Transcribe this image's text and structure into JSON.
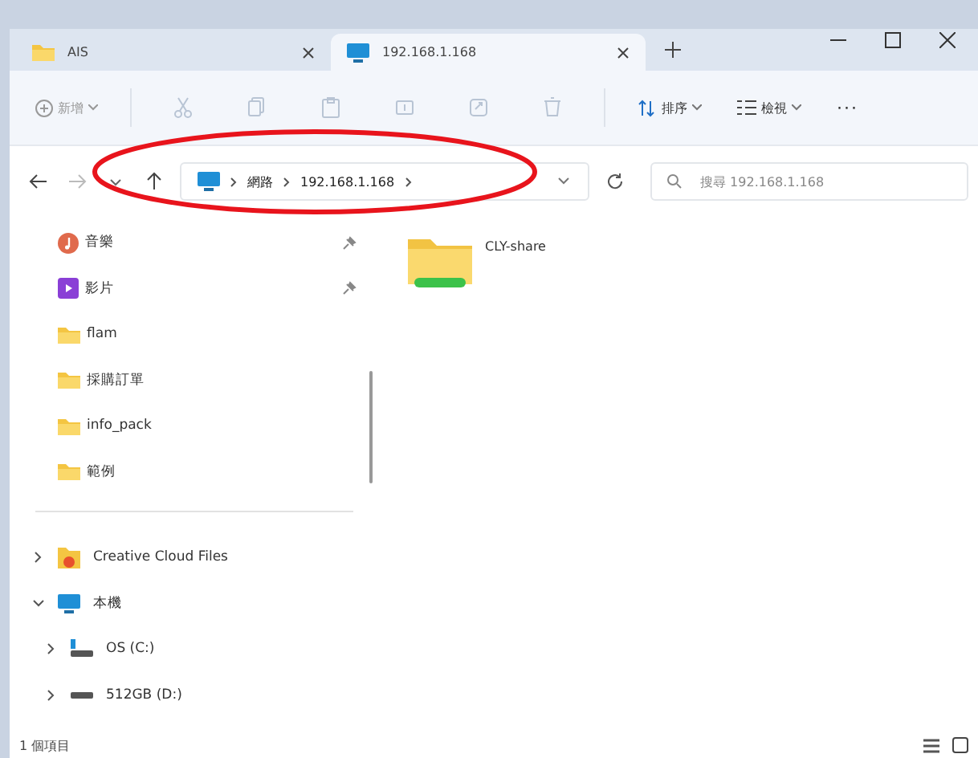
{
  "tabs": [
    {
      "label": "AIS",
      "kind": "folder",
      "selected": false
    },
    {
      "label": "192.168.1.168",
      "kind": "monitor",
      "selected": true
    }
  ],
  "toolbar": {
    "new": "新增",
    "sort": "排序",
    "view": "檢視",
    "more": "···"
  },
  "address": {
    "crumbs": [
      "網路",
      "192.168.1.168"
    ]
  },
  "search": {
    "placeholder": "搜尋 192.168.1.168"
  },
  "quick_access": [
    {
      "label": "音樂",
      "kind": "music",
      "pinned": true
    },
    {
      "label": "影片",
      "kind": "video",
      "pinned": true
    },
    {
      "label": "flam",
      "kind": "folder",
      "pinned": false
    },
    {
      "label": "採購訂單",
      "kind": "folder",
      "pinned": false
    },
    {
      "label": "info_pack",
      "kind": "folder",
      "pinned": false
    },
    {
      "label": "範例",
      "kind": "folder",
      "pinned": false
    }
  ],
  "tree": [
    {
      "label": "Creative Cloud Files",
      "kind": "cloud",
      "expanded": false
    },
    {
      "label": "本機",
      "kind": "pc",
      "expanded": true,
      "children": [
        {
          "label": "OS (C:)",
          "kind": "osdrive",
          "expanded": false
        },
        {
          "label": "512GB (D:)",
          "kind": "drive",
          "expanded": false
        }
      ]
    }
  ],
  "files": [
    {
      "name": "CLY-share",
      "kind": "share"
    }
  ],
  "status_bar": {
    "count": "1 個項目"
  },
  "annotations": [
    {
      "kind": "ellipse",
      "color": "#e8141c"
    }
  ]
}
